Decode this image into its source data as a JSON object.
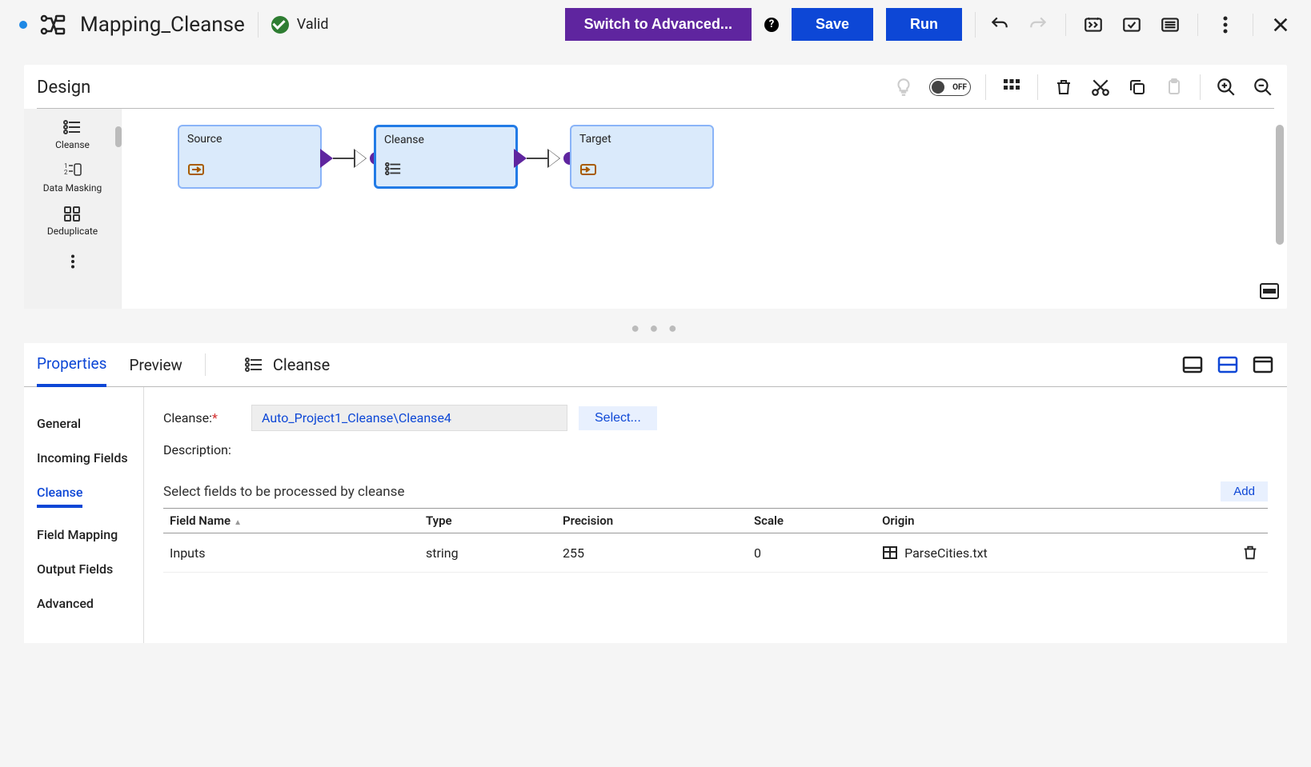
{
  "title": "Mapping_Cleanse",
  "valid_label": "Valid",
  "buttons": {
    "switch": "Switch to Advanced...",
    "save": "Save",
    "run": "Run"
  },
  "design": {
    "title": "Design",
    "toggle": "OFF",
    "palette": [
      {
        "label": "Cleanse"
      },
      {
        "label": "Data Masking"
      },
      {
        "label": "Deduplicate"
      }
    ],
    "nodes": {
      "source": "Source",
      "cleanse": "Cleanse",
      "target": "Target"
    }
  },
  "tabs": {
    "properties": "Properties",
    "preview": "Preview",
    "cleanse": "Cleanse"
  },
  "sidenav": {
    "general": "General",
    "incoming": "Incoming Fields",
    "cleanse": "Cleanse",
    "mapping": "Field Mapping",
    "output": "Output Fields",
    "advanced": "Advanced"
  },
  "form": {
    "cleanse_label": "Cleanse:",
    "cleanse_value": "Auto_Project1_Cleanse\\Cleanse4",
    "select": "Select...",
    "description": "Description:",
    "section": "Select fields to be processed by cleanse",
    "add": "Add"
  },
  "table": {
    "headers": {
      "field_name": "Field Name",
      "type": "Type",
      "precision": "Precision",
      "scale": "Scale",
      "origin": "Origin"
    },
    "row": {
      "field_name": "Inputs",
      "type": "string",
      "precision": "255",
      "scale": "0",
      "origin": "ParseCities.txt"
    }
  }
}
